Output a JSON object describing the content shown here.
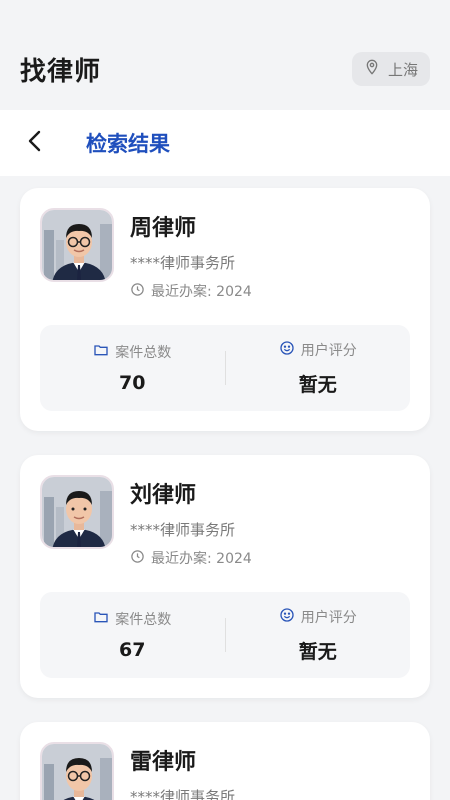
{
  "header": {
    "title": "找律师",
    "location": "上海"
  },
  "subheader": {
    "title": "检索结果"
  },
  "stats_labels": {
    "cases": "案件总数",
    "rating": "用户评分"
  },
  "lawyers": [
    {
      "name": "周律师",
      "firm": "****律师事务所",
      "recent": "最近办案: 2024",
      "cases": "70",
      "rating": "暂无"
    },
    {
      "name": "刘律师",
      "firm": "****律师事务所",
      "recent": "最近办案: 2024",
      "cases": "67",
      "rating": "暂无"
    },
    {
      "name": "雷律师",
      "firm": "****律师事务所",
      "recent": "",
      "cases": "",
      "rating": ""
    }
  ],
  "colors": {
    "accent": "#1f4fbd",
    "background": "#f3f4f6",
    "chip": "#e6e7ea"
  },
  "icons": [
    "location-pin-icon",
    "chevron-left-icon",
    "clock-icon",
    "folder-icon",
    "smile-icon"
  ]
}
